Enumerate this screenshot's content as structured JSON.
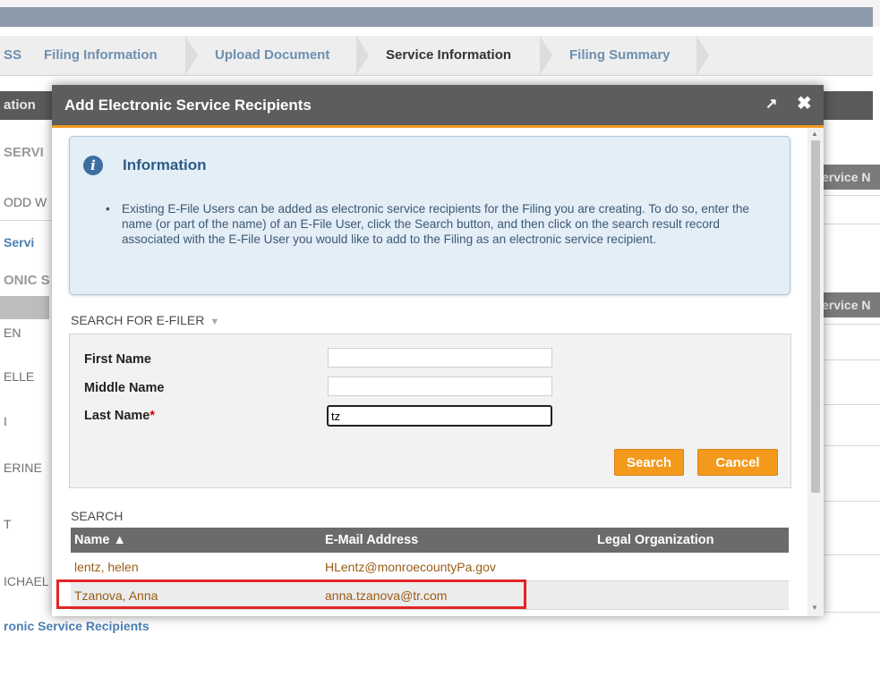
{
  "background": {
    "tabs": [
      {
        "label": "ss"
      },
      {
        "label": "Filing Information"
      },
      {
        "label": "Upload Document"
      },
      {
        "label": "Service Information"
      },
      {
        "label": "Filing Summary"
      }
    ],
    "section_label": "ation",
    "left_texts": {
      "servi": "SERVI",
      "todd": "ODD W",
      "servi_link": "Servi",
      "onic": "ONIC S",
      "en": "EN",
      "elle": "ELLE",
      "i": "I",
      "erine": "ERINE",
      "t": "T",
      "michae": "ICHAEL",
      "footer_link": "ronic Service Recipients"
    },
    "right_headers": [
      "ervice N",
      "ervice N"
    ]
  },
  "modal": {
    "title": "Add Electronic Service Recipients",
    "expand_icon": "↗",
    "close_icon": "✖",
    "info": {
      "icon": "i",
      "title": "Information",
      "text": "Existing E-File Users can be added as electronic service recipients for the Filing you are creating. To do so, enter the name (or part of the name) of an E-File User, click the Search button, and then click on the search result record associated with the E-File User you would like to add to the Filing as an electronic service recipient."
    },
    "search": {
      "title": "SEARCH FOR E-FILER",
      "first_name_label": "First Name",
      "middle_name_label": "Middle Name",
      "last_name_label": "Last Name",
      "required_marker": "*",
      "first_name_value": "",
      "middle_name_value": "",
      "last_name_value": "tz",
      "search_button": "Search",
      "cancel_button": "Cancel"
    },
    "results": {
      "title": "SEARCH",
      "columns": [
        "Name ▲",
        "E-Mail Address",
        "Legal Organization"
      ],
      "rows": [
        {
          "name": "lentz, helen",
          "email": "HLentz@monroecountyPa.gov",
          "org": ""
        },
        {
          "name": "Tzanova, Anna",
          "email": "anna.tzanova@tr.com",
          "org": ""
        }
      ]
    }
  },
  "colors": {
    "accent": "#f39a1d",
    "header": "#5d5d5d",
    "highlight": "#e32525",
    "info_bg": "#e3eef7"
  }
}
